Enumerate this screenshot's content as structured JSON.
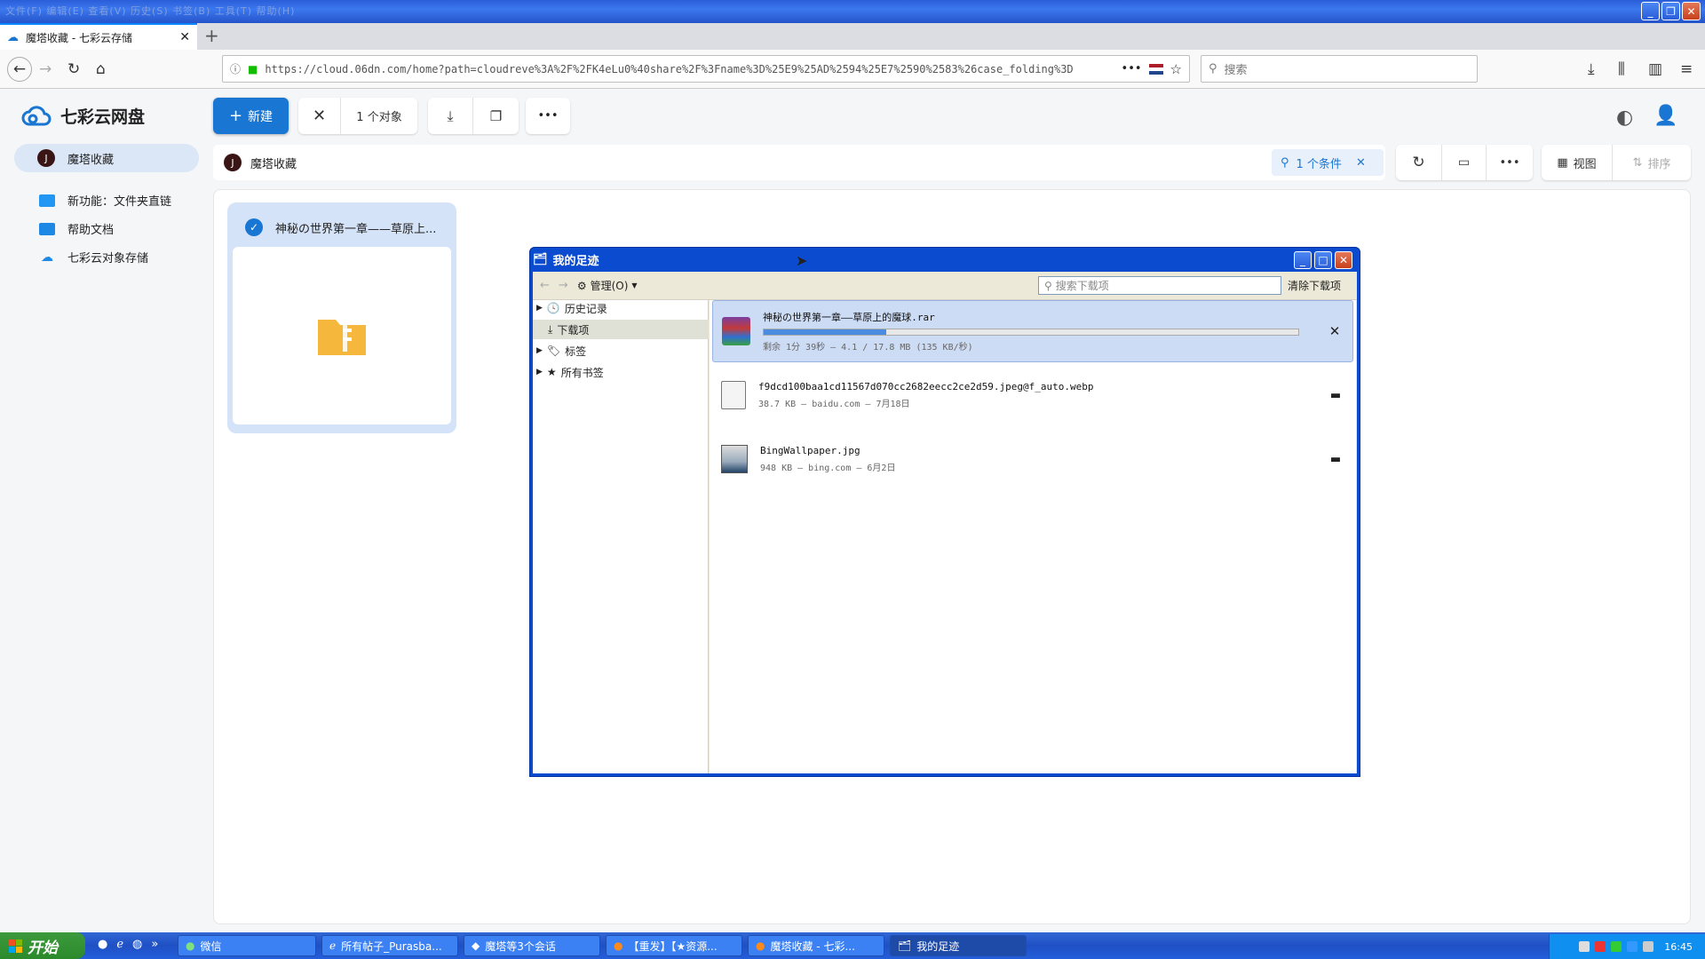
{
  "window": {
    "menu_text": "文件(F)  编辑(E)  查看(V)  历史(S)  书签(B)  工具(T)  帮助(H)"
  },
  "browser": {
    "tab_title": "魔塔收藏 - 七彩云存储",
    "url": "https://cloud.06dn.com/home?path=cloudreve%3A%2F%2FK4eLu0%40share%2F%3Fname%3D%25E9%25AD%2594%25E7%2590%2583%26case_folding%3D",
    "search_placeholder": "搜索"
  },
  "app": {
    "logo": "七彩云网盘",
    "sidebar": {
      "active": {
        "avatar": "J",
        "label": "魔塔收藏"
      },
      "items": [
        {
          "label": "新功能：文件夹直链"
        },
        {
          "label": "帮助文档"
        },
        {
          "label": "七彩云对象存储"
        }
      ]
    },
    "toolbar": {
      "new_label": "新建",
      "selection_count": "1 个对象"
    },
    "breadcrumb": {
      "avatar": "J",
      "label": "魔塔收藏"
    },
    "filter": {
      "label": "1 个条件"
    },
    "view_label": "视图",
    "sort_label": "排序",
    "card": {
      "name": "神秘の世界第一章——草原上..."
    }
  },
  "downloads_dialog": {
    "title": "我的足迹",
    "manage_label": "管理(O)",
    "search_placeholder": "搜索下载项",
    "clear_label": "清除下载项",
    "tree": [
      {
        "label": "历史记录"
      },
      {
        "label": "下载项"
      },
      {
        "label": "标签"
      },
      {
        "label": "所有书签"
      }
    ],
    "items": [
      {
        "name": "神秘の世界第一章——草原上的魔球.rar",
        "meta": "剩余 1分 39秒 — 4.1 / 17.8 MB (135 KB/秒)",
        "progress": 0.23
      },
      {
        "name": "f9dcd100baa1cd11567d070cc2682eecc2ce2d59.jpeg@f_auto.webp",
        "meta": "38.7 KB — baidu.com — 7月18日"
      },
      {
        "name": "BingWallpaper.jpg",
        "meta": "948 KB — bing.com — 6月2日"
      }
    ]
  },
  "taskbar": {
    "start_label": "开始",
    "tasks": [
      {
        "label": "微信"
      },
      {
        "label": "所有帖子_Purasba..."
      },
      {
        "label": "魔塔等3个会话"
      },
      {
        "label": "【重发】【★资源..."
      },
      {
        "label": "魔塔收藏 - 七彩..."
      },
      {
        "label": "我的足迹"
      }
    ],
    "clock": "16:45"
  }
}
